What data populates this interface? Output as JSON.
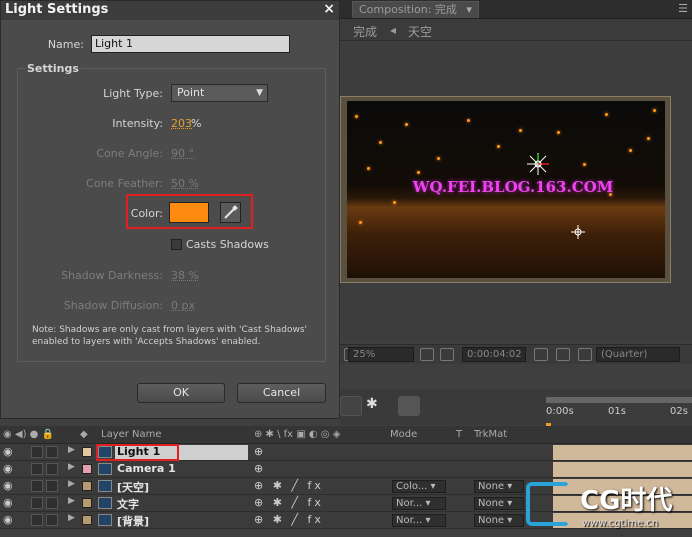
{
  "dialog": {
    "title": "Light Settings",
    "close_glyph": "×",
    "name_label": "Name:",
    "name_value": "Light 1",
    "settings_group_label": "Settings",
    "light_type_label": "Light Type:",
    "light_type_value": "Point",
    "intensity_label": "Intensity:",
    "intensity_value": "203",
    "intensity_unit": "%",
    "cone_angle_label": "Cone Angle:",
    "cone_angle_value": "90 °",
    "cone_feather_label": "Cone Feather:",
    "cone_feather_value": "50 %",
    "color_label": "Color:",
    "color_value": "#ff8a10",
    "casts_shadows_label": "Casts Shadows",
    "casts_shadows_checked": false,
    "shadow_darkness_label": "Shadow Darkness:",
    "shadow_darkness_value": "38 %",
    "shadow_diffusion_label": "Shadow Diffusion:",
    "shadow_diffusion_value": "0 px",
    "note_line1": "Note: Shadows are only cast from layers with 'Cast Shadows'",
    "note_line2": "enabled to layers with 'Accepts Shadows' enabled.",
    "ok_label": "OK",
    "cancel_label": "Cancel"
  },
  "composition": {
    "tab_label": "Composition: 完成",
    "breadcrumb_current": "完成",
    "breadcrumb_arrow": "◂",
    "breadcrumb_next": "天空",
    "scene_text": "WQ.FEI.BLOG.163.COM",
    "zoom": "25%",
    "timecode": "0:00:04:02",
    "resolution": "(Quarter)"
  },
  "timeline": {
    "ruler": [
      "0:00s",
      "01s",
      "02s"
    ],
    "columns": {
      "layer_name": "Layer Name",
      "mode": "Mode",
      "t": "T",
      "trkmat": "TrkMat"
    },
    "layers": [
      {
        "name": "Light 1",
        "chip": "#e6c8a0",
        "mode": "",
        "trkmat": "",
        "selected": true
      },
      {
        "name": "Camera 1",
        "chip": "#e0a0b0",
        "mode": "",
        "trkmat": "",
        "selected": false
      },
      {
        "name": "[天空]",
        "chip": "#b89a70",
        "mode": "Colo...",
        "trkmat": "None",
        "selected": false
      },
      {
        "name": "文字",
        "chip": "#b89a70",
        "mode": "Nor...",
        "trkmat": "None",
        "selected": false
      },
      {
        "name": "[背景]",
        "chip": "#b89a70",
        "mode": "Nor...",
        "trkmat": "None",
        "selected": false
      }
    ]
  },
  "watermark": {
    "brand": "CG时代",
    "url": "www.cgtime.cn"
  },
  "colors": {
    "accent_orange": "#e7a02a",
    "highlight_red": "#e02020",
    "swatch": "#ff8a10"
  }
}
